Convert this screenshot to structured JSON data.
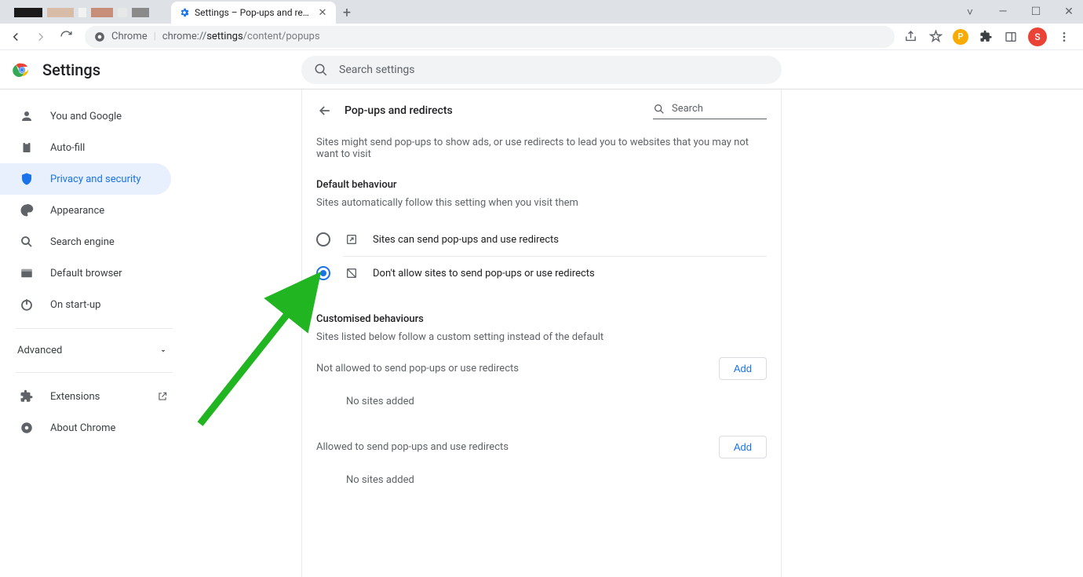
{
  "tabs": {
    "prior_blank_title": "",
    "active_title": "Settings – Pop-ups and redirects"
  },
  "toolbar": {
    "origin_icon_label": "Chrome",
    "url_prefix": "chrome://",
    "url_main": "settings",
    "url_rest": "/content/popups",
    "avatar_letter": "S"
  },
  "settings_header": {
    "title": "Settings",
    "search_placeholder": "Search settings"
  },
  "sidebar": {
    "items": [
      {
        "label": "You and Google"
      },
      {
        "label": "Auto-fill"
      },
      {
        "label": "Privacy and security"
      },
      {
        "label": "Appearance"
      },
      {
        "label": "Search engine"
      },
      {
        "label": "Default browser"
      },
      {
        "label": "On start-up"
      }
    ],
    "advanced_label": "Advanced",
    "extensions_label": "Extensions",
    "about_label": "About Chrome"
  },
  "panel": {
    "title": "Pop-ups and redirects",
    "search_placeholder": "Search",
    "description": "Sites might send pop-ups to show ads, or use redirects to lead you to websites that you may not want to visit",
    "default_behaviour_title": "Default behaviour",
    "default_behaviour_sub": "Sites automatically follow this setting when you visit them",
    "option_allow": "Sites can send pop-ups and use redirects",
    "option_block": "Don't allow sites to send pop-ups or use redirects",
    "custom_title": "Customised behaviours",
    "custom_sub": "Sites listed below follow a custom setting instead of the default",
    "not_allowed_label": "Not allowed to send pop-ups or use redirects",
    "allowed_label": "Allowed to send pop-ups and use redirects",
    "add_label": "Add",
    "no_sites": "No sites added"
  }
}
